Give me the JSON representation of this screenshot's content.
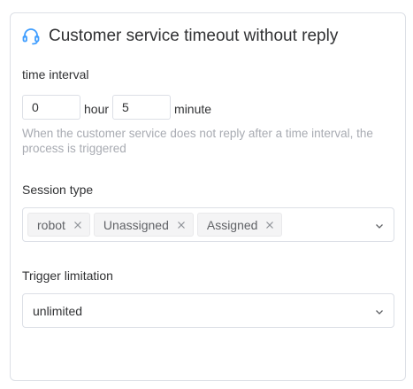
{
  "panel": {
    "title": "Customer service timeout without reply",
    "title_icon": "headset-icon",
    "accent_color": "#409eff"
  },
  "time_interval": {
    "label": "time interval",
    "hours_value": "0",
    "hours_unit": "hour",
    "minutes_value": "5",
    "minutes_unit": "minute",
    "hint": "When the customer service does not reply after a time interval, the process is triggered"
  },
  "session_type": {
    "label": "Session type",
    "selected_tags": [
      "robot",
      "Unassigned",
      "Assigned"
    ]
  },
  "trigger_limitation": {
    "label": "Trigger limitation",
    "value": "unlimited"
  }
}
